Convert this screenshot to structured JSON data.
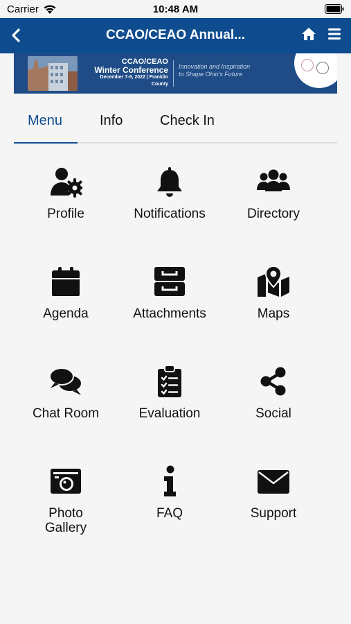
{
  "status_bar": {
    "carrier": "Carrier",
    "time": "10:48 AM"
  },
  "nav": {
    "title": "CCAO/CEAO Annual..."
  },
  "banner": {
    "line1": "CCAO/CEAO",
    "line2": "Winter Conference",
    "line3": "December 7-9, 2022 | Franklin County",
    "tagline1": "Innovation and Inspiration",
    "tagline2": "to Shape Ohio's Future"
  },
  "tabs": [
    "Menu",
    "Info",
    "Check In"
  ],
  "tiles": [
    {
      "label": "Profile",
      "icon": "user-gear-icon"
    },
    {
      "label": "Notifications",
      "icon": "bell-icon"
    },
    {
      "label": "Directory",
      "icon": "users-icon"
    },
    {
      "label": "Agenda",
      "icon": "calendar-icon"
    },
    {
      "label": "Attachments",
      "icon": "file-cabinet-icon"
    },
    {
      "label": "Maps",
      "icon": "map-icon"
    },
    {
      "label": "Chat Room",
      "icon": "chat-icon"
    },
    {
      "label": "Evaluation",
      "icon": "clipboard-check-icon"
    },
    {
      "label": "Social",
      "icon": "share-icon"
    },
    {
      "label": "Photo\nGallery",
      "icon": "camera-icon"
    },
    {
      "label": "FAQ",
      "icon": "info-icon"
    },
    {
      "label": "Support",
      "icon": "envelope-icon"
    }
  ],
  "colors": {
    "brand": "#0e4c8f",
    "icon": "#111111",
    "background": "#f5f5f5"
  }
}
